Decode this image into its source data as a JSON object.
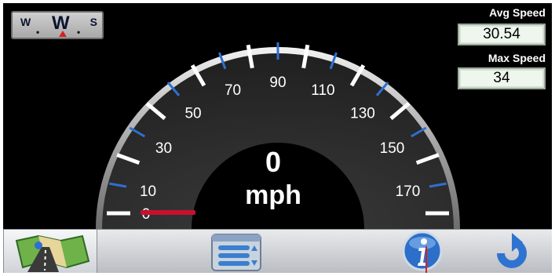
{
  "compass": {
    "left_letter": "W",
    "heading": "W",
    "right_letter": "S",
    "icon": "compass-strip-icon"
  },
  "avg_speed": {
    "label": "Avg Speed",
    "value": "30.54"
  },
  "max_speed": {
    "label": "Max Speed",
    "value": "34"
  },
  "speedometer": {
    "current_speed": "0",
    "unit": "mph",
    "min": 0,
    "max": 180,
    "needle_value": 0,
    "tick_labels": [
      "0",
      "10",
      "30",
      "50",
      "70",
      "90",
      "110",
      "130",
      "150",
      "170"
    ],
    "needle_color": "#c8102e",
    "major_tick_color": "#ffffff",
    "minor_tick_color": "#2f6fd1"
  },
  "toolbar": {
    "items": [
      {
        "icon": "map-icon",
        "active": true
      },
      {
        "icon": "list-menu-icon",
        "active": false
      },
      {
        "icon": "info-icon",
        "active": false
      },
      {
        "icon": "back-arrow-icon",
        "active": false
      }
    ]
  }
}
